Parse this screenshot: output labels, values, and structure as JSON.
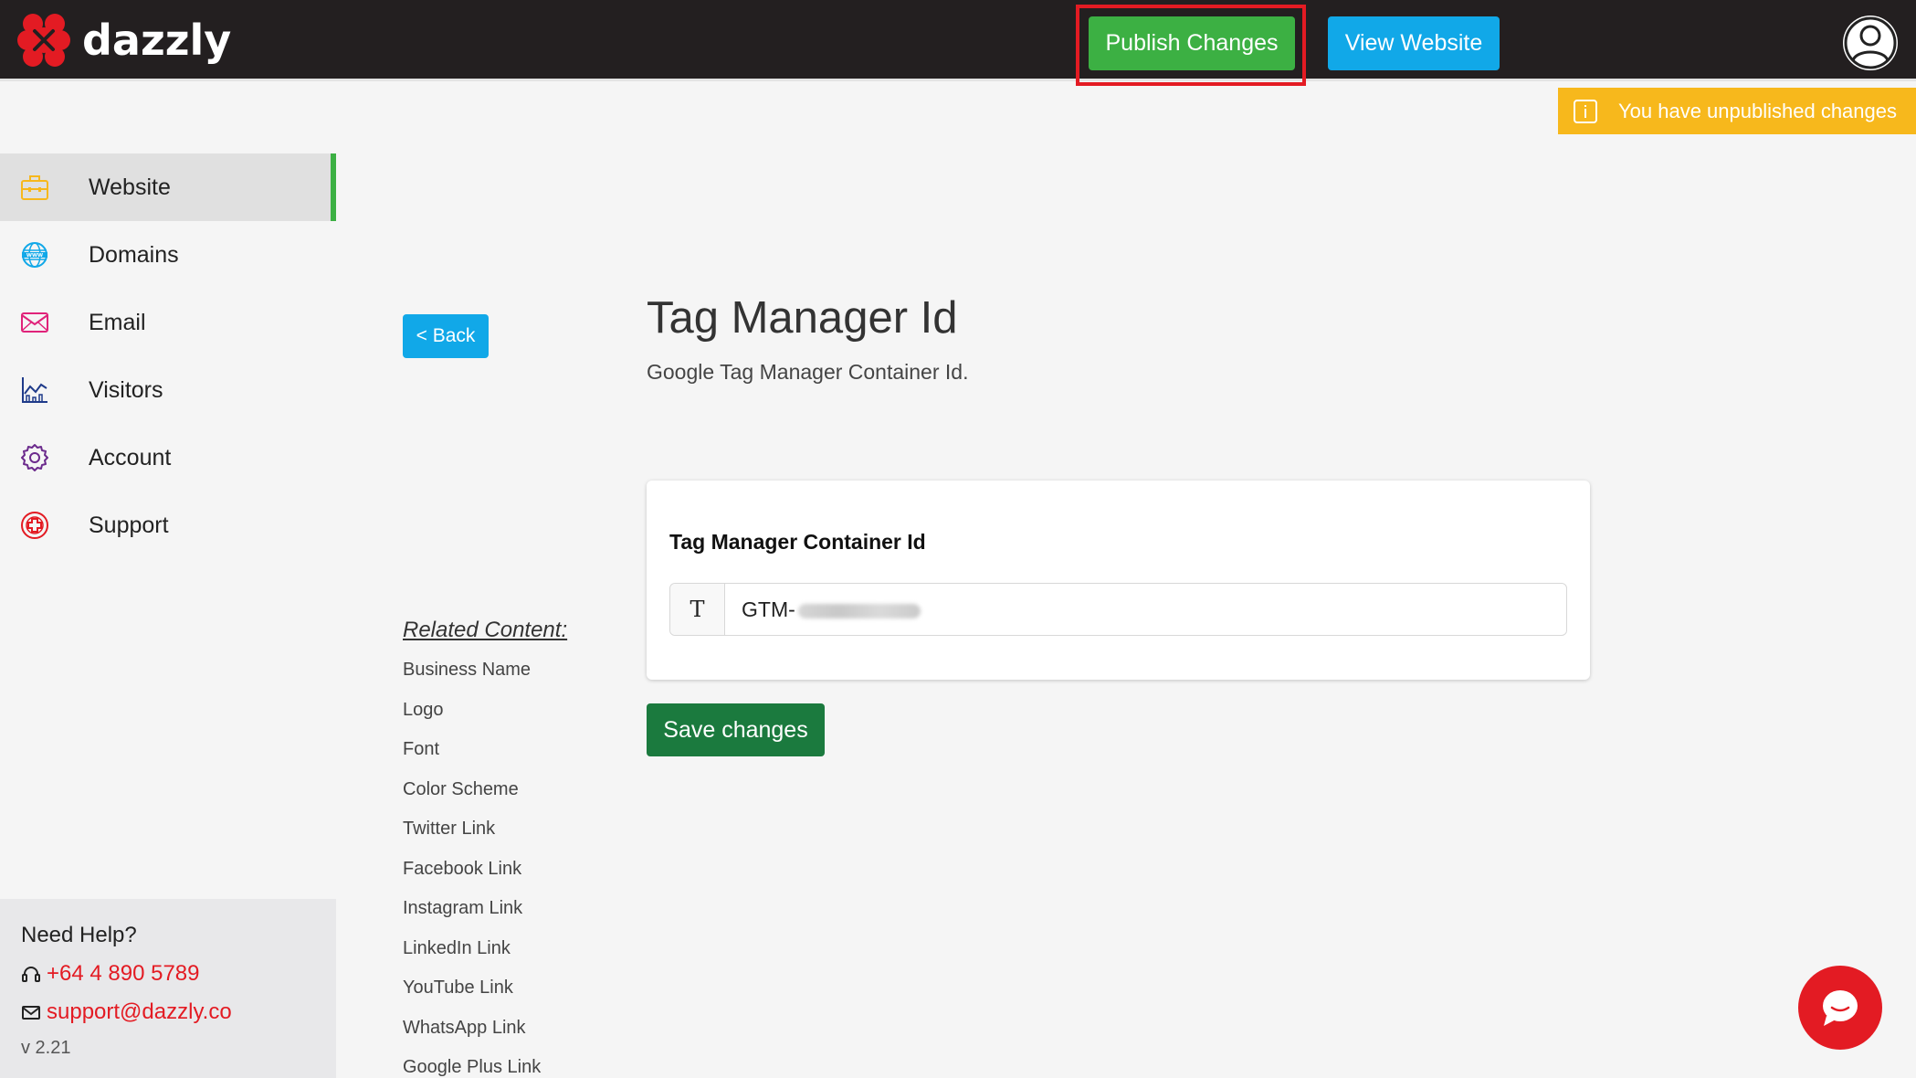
{
  "header": {
    "logo_text": "dazzly",
    "publish_label": "Publish Changes",
    "view_label": "View Website"
  },
  "notice": {
    "text": "You have unpublished changes"
  },
  "sidebar": {
    "items": [
      {
        "label": "Website",
        "icon": "briefcase-icon",
        "active": true
      },
      {
        "label": "Domains",
        "icon": "globe-icon"
      },
      {
        "label": "Email",
        "icon": "envelope-icon"
      },
      {
        "label": "Visitors",
        "icon": "chart-icon"
      },
      {
        "label": "Account",
        "icon": "gear-icon"
      },
      {
        "label": "Support",
        "icon": "lifebuoy-icon"
      }
    ]
  },
  "help": {
    "title": "Need Help?",
    "phone": "+64 4 890 5789",
    "email": "support@dazzly.co",
    "version": "v 2.21"
  },
  "back_label": "< Back",
  "related": {
    "title": "Related Content:",
    "items": [
      "Business Name",
      "Logo",
      "Font",
      "Color Scheme",
      "Twitter Link",
      "Facebook Link",
      "Instagram Link",
      "LinkedIn Link",
      "YouTube Link",
      "WhatsApp Link",
      "Google Plus Link"
    ]
  },
  "main": {
    "title": "Tag Manager Id",
    "subtitle": "Google Tag Manager Container Id.",
    "field_label": "Tag Manager Container Id",
    "field_prefix": "T",
    "field_value": "GTM-",
    "save_label": "Save changes"
  },
  "colors": {
    "topbar": "#231f20",
    "publish": "#3cb043",
    "view": "#11a8e8",
    "notice": "#f7b81c",
    "save": "#1b7a3e",
    "accent_red": "#e31b23"
  }
}
